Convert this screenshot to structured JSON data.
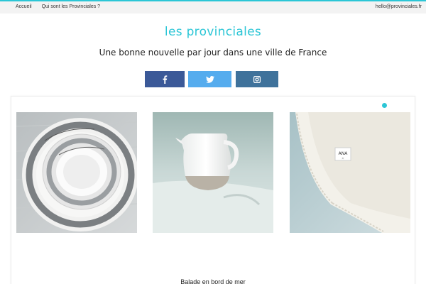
{
  "topbar": {
    "nav": [
      "Accueil",
      "Qui sont les Provinciales ?"
    ],
    "email": "hello@provinciales.fr"
  },
  "site": {
    "title": "les provinciales",
    "tagline": "Une bonne nouvelle par jour dans une ville de France"
  },
  "social": [
    {
      "network": "facebook",
      "icon": "facebook-icon",
      "color": "#3b5998"
    },
    {
      "network": "twitter",
      "icon": "twitter-icon",
      "color": "#55acee"
    },
    {
      "network": "instagram",
      "icon": "instagram-icon",
      "color": "#3f729b"
    }
  ],
  "colors": {
    "accent": "#2cc6d6"
  },
  "gallery": {
    "images": [
      {
        "alt": "plates-amour-photo"
      },
      {
        "alt": "white-jug-photo"
      },
      {
        "alt": "linen-napkin-photo"
      }
    ],
    "caption": "Balade en bord de mer"
  }
}
